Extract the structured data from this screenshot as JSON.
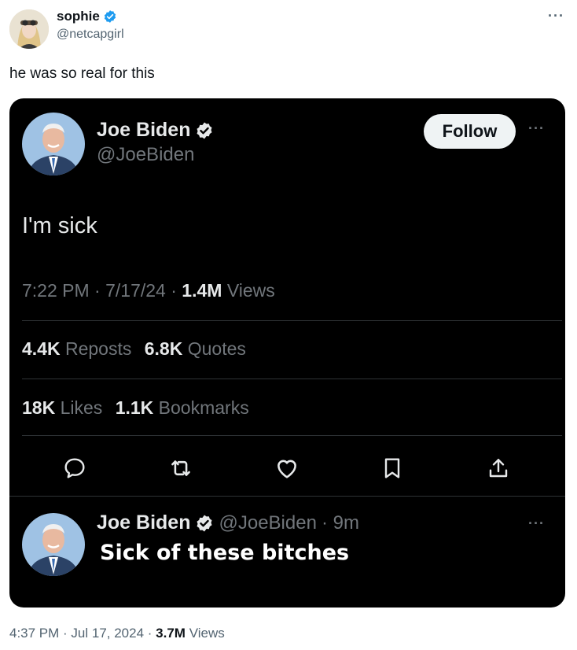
{
  "outer_tweet": {
    "author_name": "sophie",
    "author_handle": "@netcapgirl",
    "text": "he was so real for this",
    "more": "···",
    "timestamp": "4:37 PM · Jul 17, 2024 ·",
    "views_count": "3.7M",
    "views_label": "Views"
  },
  "quoted_tweet": {
    "author_name": "Joe Biden",
    "author_handle": "@JoeBiden",
    "follow_label": "Follow",
    "more": "···",
    "text": "I'm sick",
    "meta_time": "7:22 PM · 7/17/24 ·",
    "views_count": "1.4M",
    "views_label": "Views",
    "reposts_count": "4.4K",
    "reposts_label": "Reposts",
    "quotes_count": "6.8K",
    "quotes_label": "Quotes",
    "likes_count": "18K",
    "likes_label": "Likes",
    "bookmarks_count": "1.1K",
    "bookmarks_label": "Bookmarks",
    "actions": [
      "reply-icon",
      "repost-icon",
      "like-icon",
      "bookmark-icon",
      "share-icon"
    ]
  },
  "reply": {
    "author_name": "Joe Biden",
    "author_handle": "@JoeBiden",
    "time": "· 9m",
    "more": "···",
    "text": "Sick of these bitches"
  },
  "colors": {
    "verified_blue": "#1d9bf0",
    "card_bg": "#000000",
    "follow_bg": "#eff3f4"
  }
}
